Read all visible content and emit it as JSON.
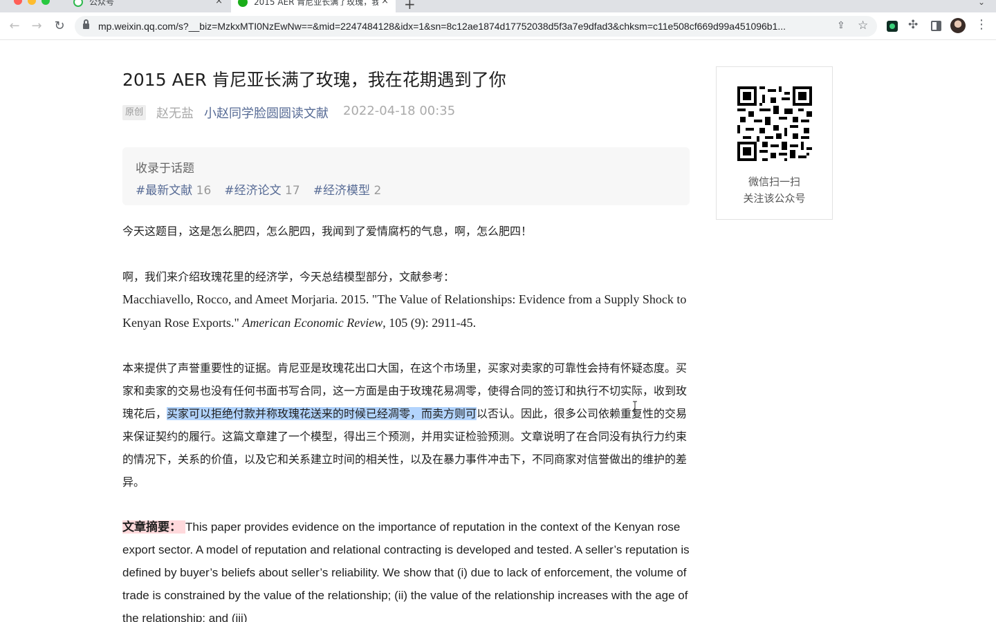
{
  "browser": {
    "tabs": [
      {
        "title": "公众号",
        "active": false
      },
      {
        "title": "2015 AER 肯尼亚长满了玫瑰，我",
        "active": true
      }
    ],
    "new_tab_label": "+",
    "url": "mp.weixin.qq.com/s?__biz=MzkxMTI0NzEwNw==&mid=2247484128&idx=1&sn=8c12ae1874d17752038d5f3a7e9dfad3&chksm=c11e508cf669d99a451096b1...",
    "icons": [
      "back-icon",
      "forward-icon",
      "reload-icon",
      "lock-icon",
      "share-icon",
      "star-icon",
      "extension-icon",
      "puzzle-icon",
      "side-panel-icon",
      "avatar",
      "menu-icon"
    ]
  },
  "article": {
    "title": "2015 AER 肯尼亚长满了玫瑰，我在花期遇到了你",
    "badge": "原创",
    "author": "赵无盐",
    "account": "小赵同学脸圆圆读文献",
    "date": "2022-04-18 00:35",
    "topics_label": "收录于话题",
    "topics": [
      {
        "name": "#最新文献",
        "count": "16"
      },
      {
        "name": "#经济论文",
        "count": "17"
      },
      {
        "name": "#经济模型",
        "count": "2"
      }
    ],
    "p1": "今天这题目，这是怎么肥四，怎么肥四，我闻到了爱情腐朽的气息，啊，怎么肥四！",
    "p2": "啊，我们来介绍玫瑰花里的经济学，今天总结模型部分，文献参考：",
    "ref_before": "Macchiavello, Rocco, and Ameet Morjaria. 2015. \"The Value of Relationships: Evidence from a Supply Shock to Kenyan Rose Exports.\" ",
    "ref_journal": "American Economic Review",
    "ref_after": ", 105 (9): 2911-45.",
    "p3_before": "本来提供了声誉重要性的证据。肯尼亚是玫瑰花出口大国，在这个市场里，买家对卖家的可靠性会持有怀疑态度。买家和卖家的交易也没有任何书面书写合同，这一方面是由于玫瑰花易凋零，使得合同的签订和执行不切实际，收到玫瑰花后，",
    "p3_highlight": "买家可以拒绝付款并称玫瑰花送来的时候已经凋零，而卖方则可",
    "p3_after": "以否认。因此，很多公司依赖重复性的交易来保证契约的履行。这篇文章建了一个模型，得出三个预测，并用实证检验预测。文章说明了在合同没有执行力约束的情况下，关系的价值，以及它和关系建立时间的相关性，以及在暴力事件冲击下，不同商家对信誉做出的维护的差异。",
    "abstract_label": "文章摘要：",
    "abstract_text": "This paper provides evidence on the importance of reputation in the context of the Kenyan rose export sector. A model of reputation and relational contracting is developed and tested. A seller’s reputation is defined by buyer’s beliefs about seller’s reliability. We show that (i) due to lack of enforcement, the volume of trade is constrained by the value of the relationship; (ii) the value of the relationship increases with the age of the relationship; and (iii)"
  },
  "qr_card": {
    "line1": "微信扫一扫",
    "line2": "关注该公众号"
  },
  "colors": {
    "link": "#576b95",
    "muted": "#aaaaaa",
    "selection": "#b3d4fd",
    "label_highlight": "#ffd9dc"
  }
}
